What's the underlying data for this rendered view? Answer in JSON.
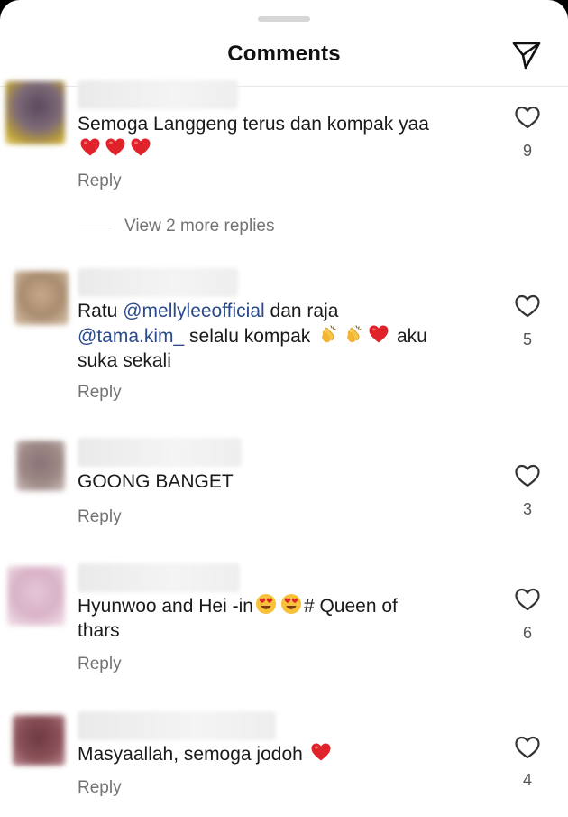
{
  "header": {
    "title": "Comments"
  },
  "comments": [
    {
      "text": "Semoga Langgeng terus dan kompak yaa",
      "likes": "9",
      "reply": "Reply",
      "view_more": "View 2 more replies"
    },
    {
      "text_prefix": "Ratu ",
      "mention1": "@mellyleeofficial",
      "text_mid": " dan raja",
      "mention2": "@tama.kim_",
      "text_after": "  selalu kompak",
      "text_end": " aku",
      "text_line3": "suka sekali",
      "likes": "5",
      "reply": "Reply"
    },
    {
      "text": "GOONG BANGET",
      "likes": "3",
      "reply": "Reply"
    },
    {
      "text_a": "Hyunwoo and Hei -in",
      "text_b": "# Queen of",
      "text_line2": "thars",
      "likes": "6",
      "reply": "Reply"
    },
    {
      "text": "Masyaallah, semoga jodoh",
      "likes": "4",
      "reply": "Reply"
    }
  ],
  "icons": {
    "share": "paper-plane-icon",
    "like": "heart-outline-icon",
    "heart_emoji": "red-heart-emoji",
    "clap_emoji": "clapping-hands-emoji",
    "heart_eyes_emoji": "heart-eyes-emoji"
  },
  "colors": {
    "mention": "#2b4a8c",
    "heart": "#e0222b",
    "secondary_text": "#737373"
  }
}
